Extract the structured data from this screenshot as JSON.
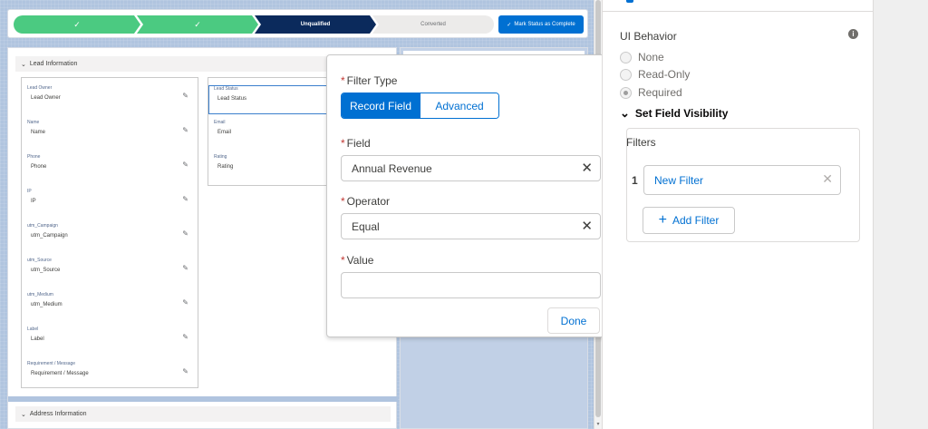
{
  "path": {
    "stages": [
      {
        "label": "✓",
        "state": "done"
      },
      {
        "label": "✓",
        "state": "done"
      },
      {
        "label": "Unqualified",
        "state": "current"
      },
      {
        "label": "Converted",
        "state": "todo"
      }
    ],
    "mark_button": "Mark Status as Complete",
    "mark_check": "✓"
  },
  "lead_section": {
    "title": "Lead Information",
    "col1": [
      {
        "label": "Lead Owner",
        "value": "Lead Owner"
      },
      {
        "label": "Name",
        "value": "Name"
      },
      {
        "label": "Phone",
        "value": "Phone"
      },
      {
        "label": "IP",
        "value": "IP"
      },
      {
        "label": "utm_Campaign",
        "value": "utm_Campaign"
      },
      {
        "label": "utm_Source",
        "value": "utm_Source"
      },
      {
        "label": "utm_Medium",
        "value": "utm_Medium"
      },
      {
        "label": "Label",
        "value": "Label"
      },
      {
        "label": "Requirement / Message",
        "value": "Requirement / Message"
      }
    ],
    "col2": [
      {
        "label": "Lead Status",
        "value": "Lead Status"
      },
      {
        "label": "Email",
        "value": "Email"
      },
      {
        "label": "Rating",
        "value": "Rating"
      }
    ]
  },
  "address_section": {
    "title": "Address Information"
  },
  "filter_popover": {
    "filter_type_label": "Filter Type",
    "record_field": "Record Field",
    "advanced": "Advanced",
    "field_label": "Field",
    "field_value": "Annual Revenue",
    "operator_label": "Operator",
    "operator_value": "Equal",
    "value_label": "Value",
    "value_value": "",
    "done": "Done",
    "required_mark": "*"
  },
  "properties": {
    "ui_behavior_label": "UI Behavior",
    "options": [
      "None",
      "Read-Only",
      "Required"
    ],
    "selected_option": "Required",
    "visibility_label": "Set Field Visibility",
    "filters_label": "Filters",
    "filter_index": "1",
    "filter_name": "New Filter",
    "add_filter": "Add Filter"
  },
  "colors": {
    "accent": "#0070d2",
    "path_done": "#4bca81",
    "path_current": "#0b2a5c",
    "canvas_bg": "#b0c4df"
  },
  "icons": {
    "pencil": "edit-icon",
    "clear": "clear-icon",
    "info": "info-icon",
    "chevron": "chevron-down-icon",
    "close": "close-icon",
    "plus": "plus-icon"
  }
}
